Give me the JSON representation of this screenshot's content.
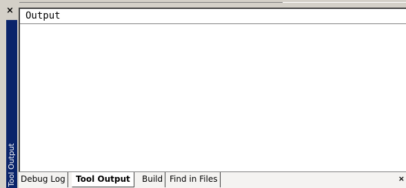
{
  "window": {
    "close_glyph": "×",
    "gripper_label": "Tool Output"
  },
  "pane": {
    "title": "Output",
    "content": ""
  },
  "tabs": [
    {
      "label": "Debug Log",
      "active": false
    },
    {
      "label": "Tool Output",
      "active": true
    },
    {
      "label": "Build",
      "active": false
    },
    {
      "label": "Find in Files",
      "active": false
    }
  ],
  "tab_strip": {
    "close_glyph": "×"
  },
  "colors": {
    "gripper": "#0a246a",
    "chrome": "#d4d0c8",
    "pane_background": "#ffffff"
  },
  "icons": [
    "close-icon",
    "tab-strip-close-icon"
  ]
}
